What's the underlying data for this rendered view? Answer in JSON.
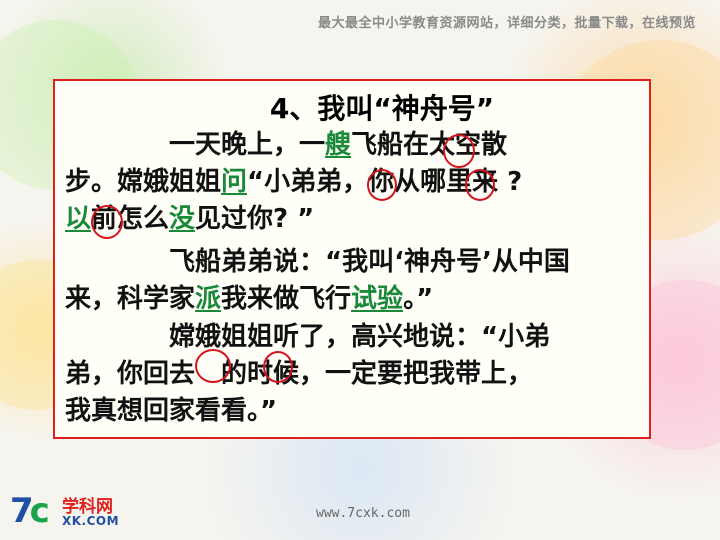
{
  "header": {
    "tagline": "最大最全中小学教育资源网站，详细分类，批量下载，在线预览"
  },
  "lesson": {
    "title": "4、我叫“神舟号”",
    "p1": {
      "l1a": "一天晚上，一",
      "l1b": "艘",
      "l1c": "飞船在太空散",
      "l2a": "步。嫦娥姐姐",
      "l2b": "问",
      "l2c": "“小弟弟，你从哪里来 ?",
      "l3a": "以",
      "l3b": "前怎么",
      "l3c": "没",
      "l3d": "见过你? ”"
    },
    "p2": {
      "l1": "飞船弟弟说：“我叫‘神舟号’从中国",
      "l2a": "来，科学家",
      "l2b": "派",
      "l2c": "我来做飞行",
      "l2d": "试验",
      "l2e": "。”"
    },
    "p3": {
      "l1": "嫦娥姐姐听了，高兴地说：“小弟",
      "l2a": "弟，你回去",
      "l2b": "的时候，一定要把我带上，",
      "l3": "我真想回家看看。”"
    },
    "annotation_color": "#d4141c",
    "highlight_color": "#1a8a3a"
  },
  "footer": {
    "url": "www.7cxk.com",
    "logo_mark_a": "7",
    "logo_mark_b": "c",
    "logo_name": "学科网",
    "logo_domain": "XK.COM"
  }
}
